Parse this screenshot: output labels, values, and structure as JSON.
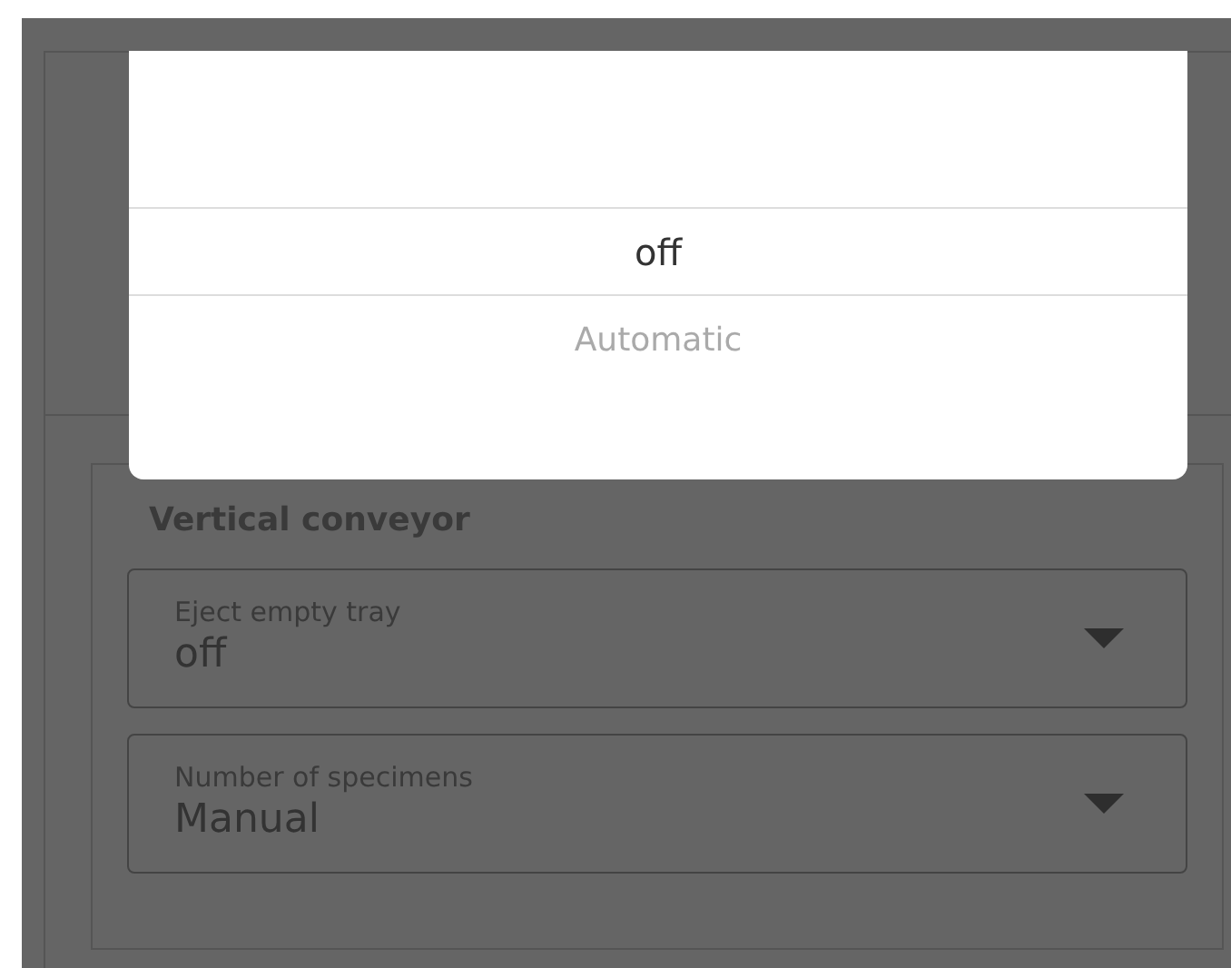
{
  "picker": {
    "options": [
      {
        "label": "off",
        "selected": true
      },
      {
        "label": "Automatic",
        "selected": false
      }
    ]
  },
  "section": {
    "title": "Vertical conveyor",
    "fields": [
      {
        "label": "Eject empty tray",
        "value": "off"
      },
      {
        "label": "Number of specimens",
        "value": "Manual"
      }
    ]
  }
}
